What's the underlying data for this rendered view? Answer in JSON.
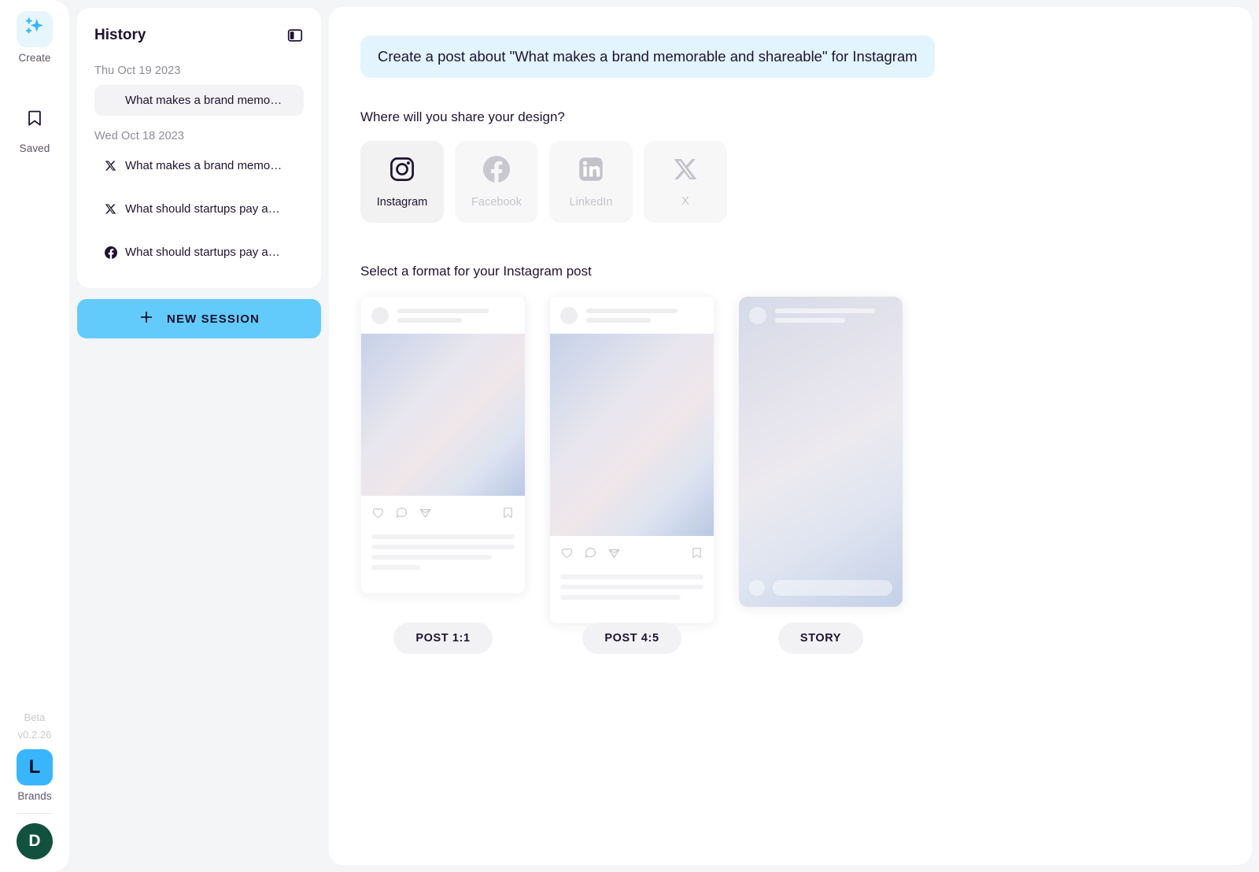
{
  "rail": {
    "items": [
      {
        "label": "Create",
        "icon": "sparkles-icon",
        "active": true
      },
      {
        "label": "Saved",
        "icon": "bookmark-icon",
        "active": false
      }
    ],
    "beta_line1": "Beta",
    "beta_line2": "v0.2.26",
    "brand": {
      "initial": "L",
      "label": "Brands",
      "color": "#39b6fb"
    },
    "avatar": {
      "initial": "D",
      "color": "#13513f"
    }
  },
  "history": {
    "title": "History",
    "toggle_icon": "panel-toggle-icon",
    "groups": [
      {
        "date": "Thu Oct 19 2023",
        "items": [
          {
            "icon": "none",
            "text": "What makes a brand memo…",
            "selected": true
          }
        ]
      },
      {
        "date": "Wed Oct 18 2023",
        "items": [
          {
            "icon": "x-icon",
            "text": "What makes a brand memo…",
            "selected": false
          },
          {
            "icon": "x-icon",
            "text": "What should startups pay a…",
            "selected": false
          },
          {
            "icon": "facebook-icon",
            "text": "What should startups pay a…",
            "selected": false
          }
        ]
      }
    ],
    "new_session_label": "NEW SESSION"
  },
  "main": {
    "prompt": "Create a post about \"What makes a brand memorable and shareable\" for Instagram",
    "share_question": "Where will you share your design?",
    "platforms": [
      {
        "label": "Instagram",
        "icon": "instagram-icon",
        "active": true
      },
      {
        "label": "Facebook",
        "icon": "facebook-icon",
        "active": false
      },
      {
        "label": "LinkedIn",
        "icon": "linkedin-icon",
        "active": false
      },
      {
        "label": "X",
        "icon": "x-icon",
        "active": false
      }
    ],
    "format_question": "Select a format for your Instagram post",
    "formats": [
      {
        "label": "POST 1:1",
        "kind": "post-square"
      },
      {
        "label": "POST 4:5",
        "kind": "post-portrait"
      },
      {
        "label": "STORY",
        "kind": "story"
      }
    ]
  },
  "colors": {
    "accent": "#62cbfb",
    "prompt_bg": "#e2f4fd",
    "brand_blue": "#39b6fb",
    "avatar_green": "#13513f",
    "text": "#1f1333",
    "muted": "#8f8b99"
  }
}
